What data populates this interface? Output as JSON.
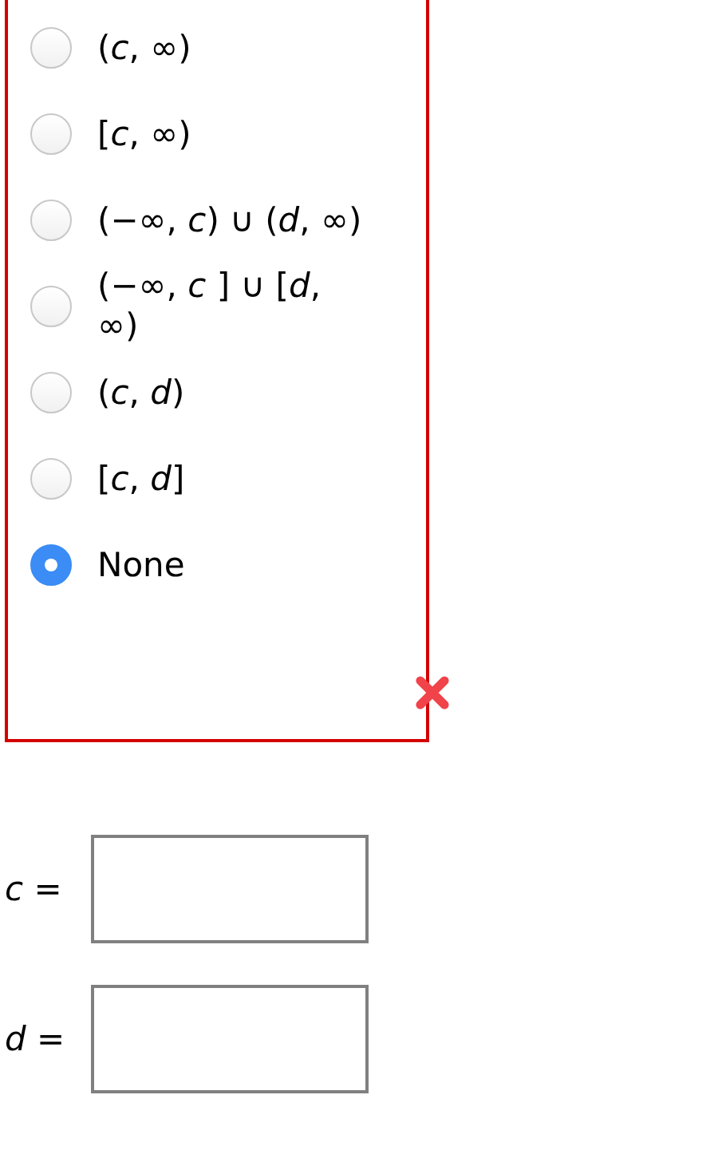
{
  "options": [
    {
      "label": "(*c*, ∞)",
      "selected": false
    },
    {
      "label": "[*c*, ∞)",
      "selected": false
    },
    {
      "label": "(−∞, *c*) ∪ (*d*, ∞)",
      "selected": false
    },
    {
      "label": "(−∞, *c* ] ∪ [*d*, ∞)",
      "selected": false
    },
    {
      "label": "(*c*, *d*)",
      "selected": false
    },
    {
      "label": "[*c*, *d*]",
      "selected": false
    },
    {
      "label": "None",
      "selected": true
    }
  ],
  "answer_incorrect": true,
  "fields": [
    {
      "label": "*c* ="
    },
    {
      "label": "*d* ="
    }
  ]
}
